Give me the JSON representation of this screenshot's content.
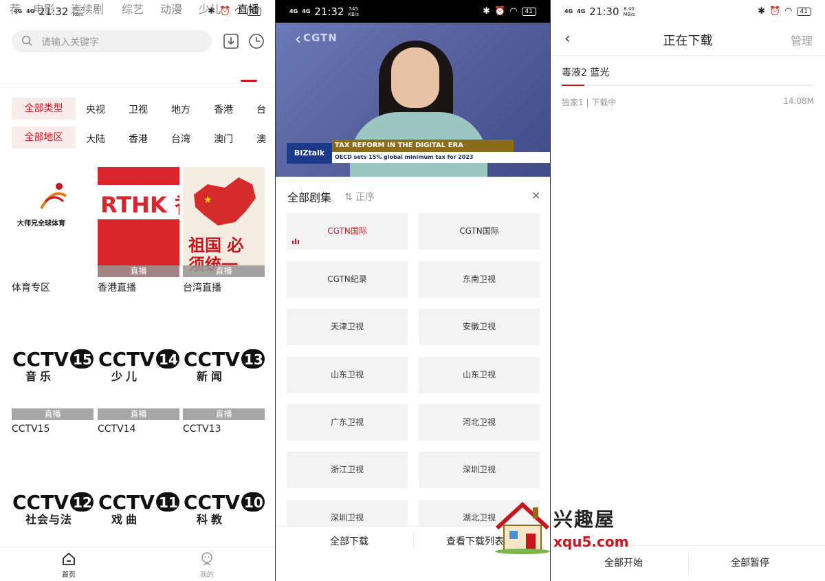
{
  "panel1": {
    "status": {
      "sig1": "4G",
      "sig2": "4G",
      "time": "21:32",
      "speed": "60.7",
      "speed_unit": "KB/s",
      "battery": "41"
    },
    "search": {
      "placeholder": "请输入关键字"
    },
    "tabs": [
      "荐",
      "电影",
      "连续剧",
      "综艺",
      "动漫",
      "少儿",
      "直播"
    ],
    "active_tab": "直播",
    "type_filters": [
      "全部类型",
      "央视",
      "卫视",
      "地方",
      "香港",
      "台"
    ],
    "region_filters": [
      "全部地区",
      "大陆",
      "香港",
      "台湾",
      "澳门",
      "澳"
    ],
    "tiles": [
      {
        "title": "体育专区",
        "label": "",
        "logo_text": "大师兄全球体育"
      },
      {
        "title": "香港直播",
        "label": "直播",
        "logo_text": "RTHK 香港電台"
      },
      {
        "title": "台湾直播",
        "label": "直播",
        "logo_text": "祖国 必须统一"
      },
      {
        "title": "CCTV15",
        "label": "直播",
        "num": "15",
        "sub": "音乐"
      },
      {
        "title": "CCTV14",
        "label": "直播",
        "num": "14",
        "sub": "少儿"
      },
      {
        "title": "CCTV13",
        "label": "直播",
        "num": "13",
        "sub": "新闻"
      },
      {
        "title": "",
        "label": "",
        "num": "12",
        "sub": "社会与法"
      },
      {
        "title": "",
        "label": "",
        "num": "11",
        "sub": "戏曲"
      },
      {
        "title": "",
        "label": "",
        "num": "10",
        "sub": "科教"
      }
    ],
    "nav": {
      "home": "首页",
      "mine": "我的"
    }
  },
  "panel2": {
    "status": {
      "sig1": "4G",
      "sig2": "4G",
      "time": "21:32",
      "speed": "545",
      "speed_unit": "KB/s",
      "battery": "41"
    },
    "video": {
      "channel_logo": "CGTN",
      "badge": "BIZtalk",
      "headline": "TAX REFORM IN THE DIGITAL ERA",
      "subline": "OECD sets 15% global minimum tax for 2023"
    },
    "episodes_title": "全部剧集",
    "sort_label": "正序",
    "episodes": [
      "CGTN国际",
      "CGTN国际",
      "CGTN纪录",
      "东南卫视",
      "天津卫视",
      "安徽卫视",
      "山东卫视",
      "山东卫视",
      "广东卫视",
      "河北卫视",
      "浙江卫视",
      "深圳卫视",
      "深圳卫视",
      "湖北卫视"
    ],
    "download_all": "全部下载",
    "view_list": "查看下载列表"
  },
  "panel3": {
    "status": {
      "sig1": "4G",
      "sig2": "4G",
      "time": "21:30",
      "speed": "8.40",
      "speed_unit": "MB/s",
      "battery": "41"
    },
    "title": "正在下载",
    "manage": "管理",
    "item": {
      "title": "毒液2 蓝光",
      "status": "独家1 | 下载中",
      "size": "14.08M",
      "progress": 0.09
    },
    "start_all": "全部开始",
    "pause_all": "全部暂停"
  },
  "watermark": {
    "cn": "兴趣屋",
    "en": "xqu5.com"
  },
  "colors": {
    "accent": "#c8161e"
  }
}
